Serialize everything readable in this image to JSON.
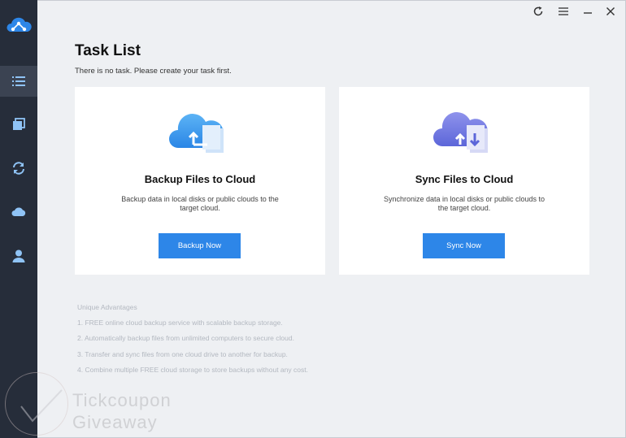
{
  "sidebar": {
    "logo": "cloud-network-logo",
    "items": [
      {
        "name": "task-list",
        "icon": "list-icon",
        "active": true
      },
      {
        "name": "backup",
        "icon": "copy-icon",
        "active": false
      },
      {
        "name": "sync",
        "icon": "sync-icon",
        "active": false
      },
      {
        "name": "cloud",
        "icon": "cloud-icon",
        "active": false
      },
      {
        "name": "account",
        "icon": "user-icon",
        "active": false
      }
    ]
  },
  "window_controls": [
    "refresh-icon",
    "menu-icon",
    "minimize-icon",
    "close-icon"
  ],
  "main": {
    "title": "Task List",
    "subtitle": "There is no task. Please create your task first.",
    "cards": [
      {
        "title": "Backup Files to Cloud",
        "description": "Backup data in local disks or public clouds to the target cloud.",
        "button_label": "Backup Now"
      },
      {
        "title": "Sync Files to Cloud",
        "description": "Synchronize data in local disks or public clouds to the target cloud.",
        "button_label": "Sync Now"
      }
    ],
    "advantages_title": "Unique Advantages",
    "advantages": [
      "1. FREE online cloud backup service with scalable backup storage.",
      "2. Automatically backup files from unlimited computers to secure cloud.",
      "3. Transfer and sync files from one cloud drive to another for backup.",
      "4. Combine multiple FREE cloud storage to store backups without any cost."
    ]
  },
  "watermark": {
    "line1": "Tickcoupon",
    "line2": "Giveaway"
  },
  "colors": {
    "sidebar_bg": "#262d3a",
    "sidebar_active": "#3b4352",
    "sidebar_icon": "#8fc3f5",
    "accent": "#2d86e8",
    "background": "#eef0f3",
    "card_bg": "#ffffff"
  }
}
